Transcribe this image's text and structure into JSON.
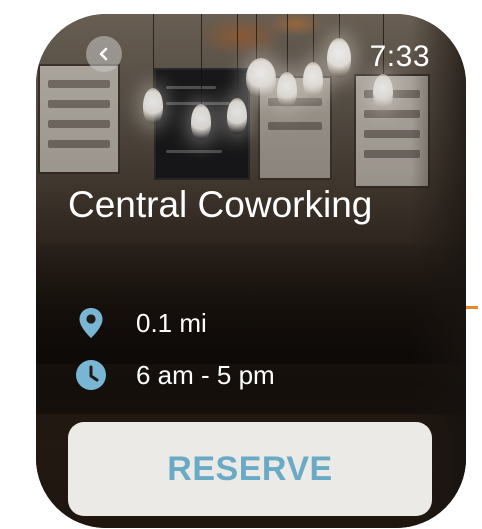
{
  "status": {
    "time": "7:33"
  },
  "venue": {
    "name": "Central Coworking"
  },
  "details": [
    {
      "icon": "location-pin-icon",
      "text": "0.1 mi"
    },
    {
      "icon": "clock-icon",
      "text": "6 am - 5 pm"
    }
  ],
  "actions": {
    "reserve_label": "RESERVE"
  },
  "colors": {
    "accent": "#6aaac4",
    "icon": "#79b6d3",
    "button_bg": "#eceae6",
    "text": "#ffffff"
  }
}
